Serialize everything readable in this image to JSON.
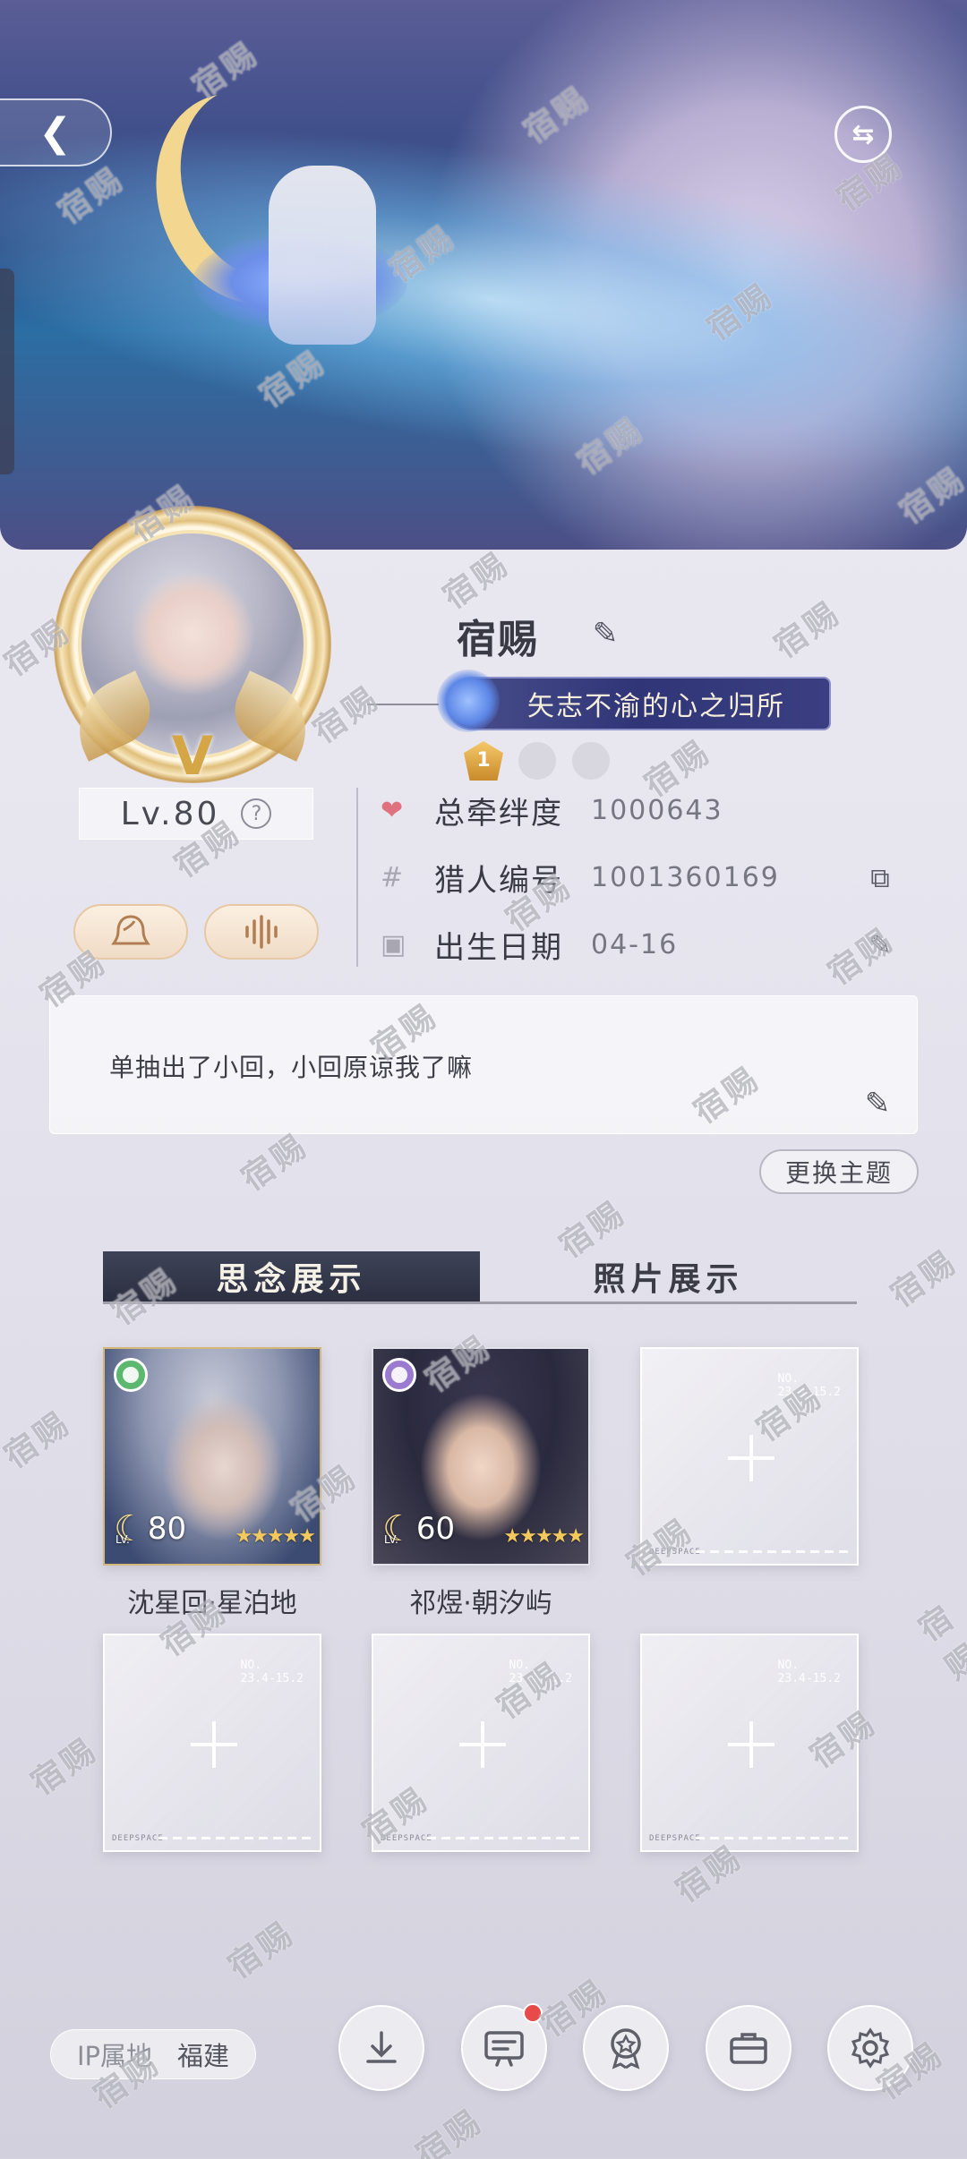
{
  "header": {
    "back_icon": "chevron-left-icon",
    "swap_icon": "swap-arrows-icon"
  },
  "profile": {
    "name": "宿赐",
    "title_badge": "矢志不渝的心之归所",
    "level": "Lv.80",
    "help_symbol": "?",
    "medal_rank": "1",
    "stats": [
      {
        "icon": "heart-icon",
        "label": "总牵绊度",
        "value": "1000643"
      },
      {
        "icon": "hash-icon",
        "label": "猎人编号",
        "value": "1001360169"
      },
      {
        "icon": "cake-icon",
        "label": "出生日期",
        "value": "04-16"
      }
    ],
    "signature": "单抽出了小回，小回原谅我了嘛"
  },
  "buttons": {
    "change_theme": "更换主题"
  },
  "tabs": [
    {
      "label": "思念展示",
      "active": true
    },
    {
      "label": "照片展示",
      "active": false
    }
  ],
  "cards": [
    {
      "type": "character",
      "name": "沈星回·星泊地",
      "level": "80",
      "stars": "★★★★★",
      "rarity_color": "#5cb86e"
    },
    {
      "type": "character",
      "name": "祁煜·朝汐屿",
      "level": "60",
      "stars": "★★★★★",
      "rarity_color": "#9a7bd0"
    },
    {
      "type": "empty",
      "no_label": "NO.",
      "code": "23.4-15.2"
    },
    {
      "type": "empty",
      "no_label": "NO.",
      "code": "23.4-15.2"
    },
    {
      "type": "empty",
      "no_label": "NO.",
      "code": "23.4-15.2"
    },
    {
      "type": "empty",
      "no_label": "NO.",
      "code": "23.4-15.2"
    }
  ],
  "card_footer": "DEEPSPACE",
  "card_lv_label": "LV.",
  "bottom": {
    "ip_label": "IP属地",
    "ip_value": "福建",
    "actions": [
      {
        "icon": "download-icon"
      },
      {
        "icon": "message-board-icon",
        "has_notification": true
      },
      {
        "icon": "badge-icon"
      },
      {
        "icon": "briefcase-icon"
      },
      {
        "icon": "gear-icon"
      }
    ]
  },
  "watermark": "宿赐"
}
